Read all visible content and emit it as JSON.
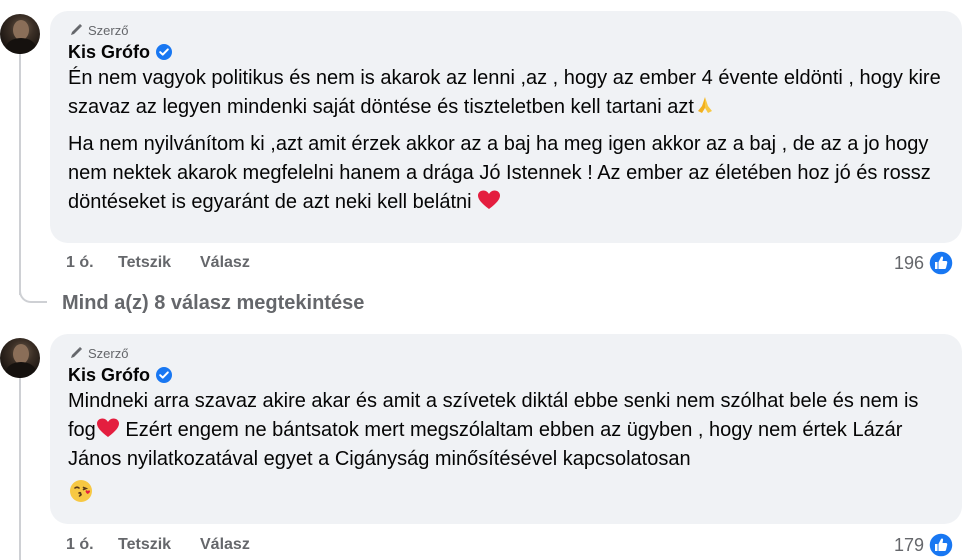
{
  "comments": [
    {
      "badge": "Szerző",
      "author": "Kis Grófo",
      "paragraphs": [
        "Én nem vagyok politikus és nem is akarok az lenni ,az , hogy az ember 4 évente eldönti , hogy kire szavaz az legyen mindenki saját döntése és tiszteletben kell tartani azt",
        "Ha nem nyilvánítom ki ,azt amit érzek akkor az a baj ha meg igen akkor az a baj , de az a jo hogy nem nektek akarok megfelelni hanem a drága Jó Istennek ! Az ember az életében hoz jó és rossz döntéseket is egyaránt de azt neki kell belátni"
      ],
      "time": "1 ó.",
      "like_label": "Tetszik",
      "reply_label": "Válasz",
      "reaction_count": "196"
    },
    {
      "badge": "Szerző",
      "author": "Kis Grófo",
      "text_a": "Mindneki arra szavaz akire akar és amit a szívetek diktál ebbe senki nem szólhat bele és nem is fog",
      "text_b": " Ezért engem ne bántsatok mert megszólaltam ebben az ügyben , hogy nem értek Lázár János nyilatkozatával egyet a Cigányság minősítésével kapcsolatosan",
      "time": "1 ó.",
      "like_label": "Tetszik",
      "reply_label": "Válasz",
      "reaction_count": "179"
    }
  ],
  "view_replies": "Mind a(z) 8 válasz megtekintése",
  "icons": [
    "pencil-icon",
    "verified-icon",
    "praying-hands-icon",
    "red-heart-icon",
    "kiss-emoji-icon",
    "like-reaction-icon"
  ],
  "colors": {
    "bubble": "#f0f2f5",
    "verified": "#1877f2",
    "like": "#1877f2",
    "muted": "#65676b",
    "heart": "#e41e3f"
  }
}
